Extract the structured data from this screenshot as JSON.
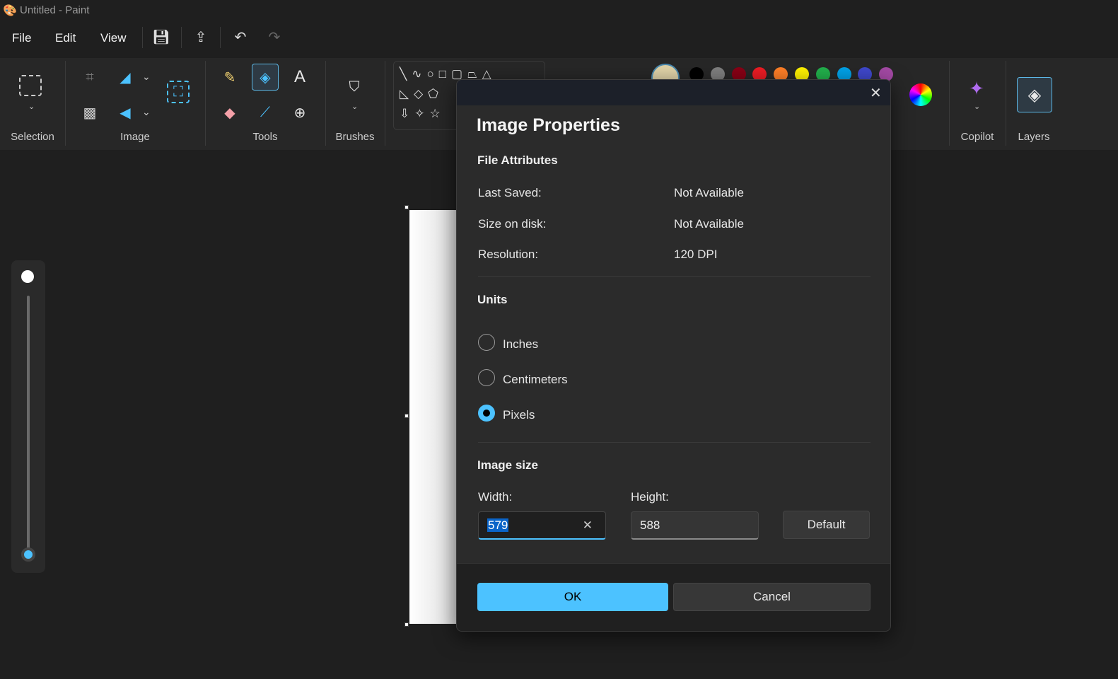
{
  "window": {
    "title": "Untitled - Paint"
  },
  "menu": {
    "file": "File",
    "edit": "Edit",
    "view": "View"
  },
  "ribbon": {
    "groups": {
      "selection": "Selection",
      "image": "Image",
      "tools": "Tools",
      "brushes": "Brushes",
      "copilot": "Copilot",
      "layers": "Layers"
    }
  },
  "palette": [
    "#000000",
    "#7f7f7f",
    "#880015",
    "#ed1c24",
    "#ff7f27",
    "#fff200",
    "#22b14c",
    "#00a2e8",
    "#3f48cc",
    "#a349a4"
  ],
  "dialog": {
    "title": "Image Properties",
    "file_attributes": {
      "heading": "File Attributes",
      "last_saved_label": "Last Saved:",
      "last_saved": "Not Available",
      "size_label": "Size on disk:",
      "size": "Not Available",
      "resolution_label": "Resolution:",
      "resolution": "120 DPI"
    },
    "units": {
      "heading": "Units",
      "options": [
        "Inches",
        "Centimeters",
        "Pixels"
      ],
      "selected": "Pixels"
    },
    "image_size": {
      "heading": "Image size",
      "width_label": "Width:",
      "width": "579",
      "height_label": "Height:",
      "height": "588",
      "default_label": "Default"
    },
    "ok": "OK",
    "cancel": "Cancel"
  }
}
